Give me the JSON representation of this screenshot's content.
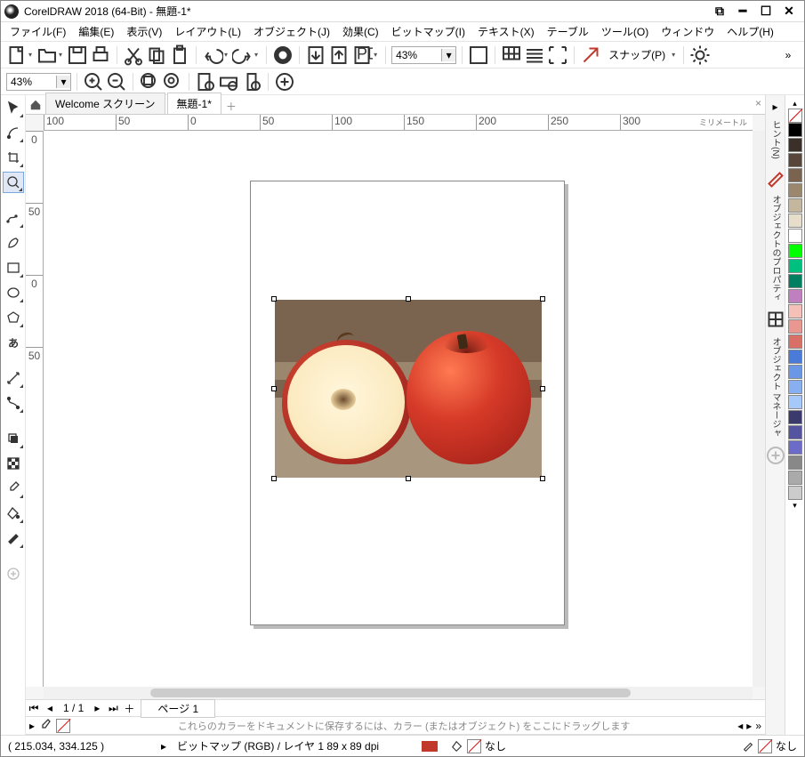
{
  "title": "CorelDRAW 2018 (64-Bit) - 無題-1*",
  "menu": [
    "ファイル(F)",
    "編集(E)",
    "表示(V)",
    "レイアウト(L)",
    "オブジェクト(J)",
    "効果(C)",
    "ビットマップ(I)",
    "テキスト(X)",
    "テーブル",
    "ツール(O)",
    "ウィンドウ",
    "ヘルプ(H)"
  ],
  "zoom1": "43%",
  "zoom2": "43%",
  "snap": "スナップ(P)",
  "tabs": {
    "welcome": "Welcome スクリーン",
    "doc": "無題-1*"
  },
  "rulerh": [
    "100",
    "50",
    "0",
    "50",
    "100",
    "150",
    "200",
    "250",
    "300"
  ],
  "rulerv": [
    "0",
    "50",
    "0",
    "50"
  ],
  "rulerunit": "ミリメートル",
  "page": {
    "count": "1 / 1",
    "addplus": "＋",
    "tab": "ページ 1"
  },
  "colorhint": "これらのカラーをドキュメントに保存するには、カラー (またはオブジェクト) をここにドラッグします",
  "docks": {
    "hint": "ヒント(N)",
    "prop": "オブジェクトのプロパティ",
    "mgr": "オブジェクト マネージャ"
  },
  "status": {
    "coords": "( 215.034, 334.125 )",
    "info": "ビットマップ (RGB) / レイヤ 1 89 x 89 dpi",
    "none": "なし"
  },
  "palette": [
    "#000000",
    "#3b2f2a",
    "#59463a",
    "#7a6450",
    "#9b876e",
    "#c4b79e",
    "#e6ddcb",
    "#ffffff",
    "#00ff00",
    "#00c080",
    "#008060",
    "#c080c0",
    "#f5c0b8",
    "#e89890",
    "#d87068",
    "#4b7bd8",
    "#6a97e6",
    "#88b0f0",
    "#a6c9fa",
    "#3a3a6c",
    "#5454a0",
    "#6c6cc8",
    "#888888",
    "#aaaaaa",
    "#cccccc"
  ]
}
